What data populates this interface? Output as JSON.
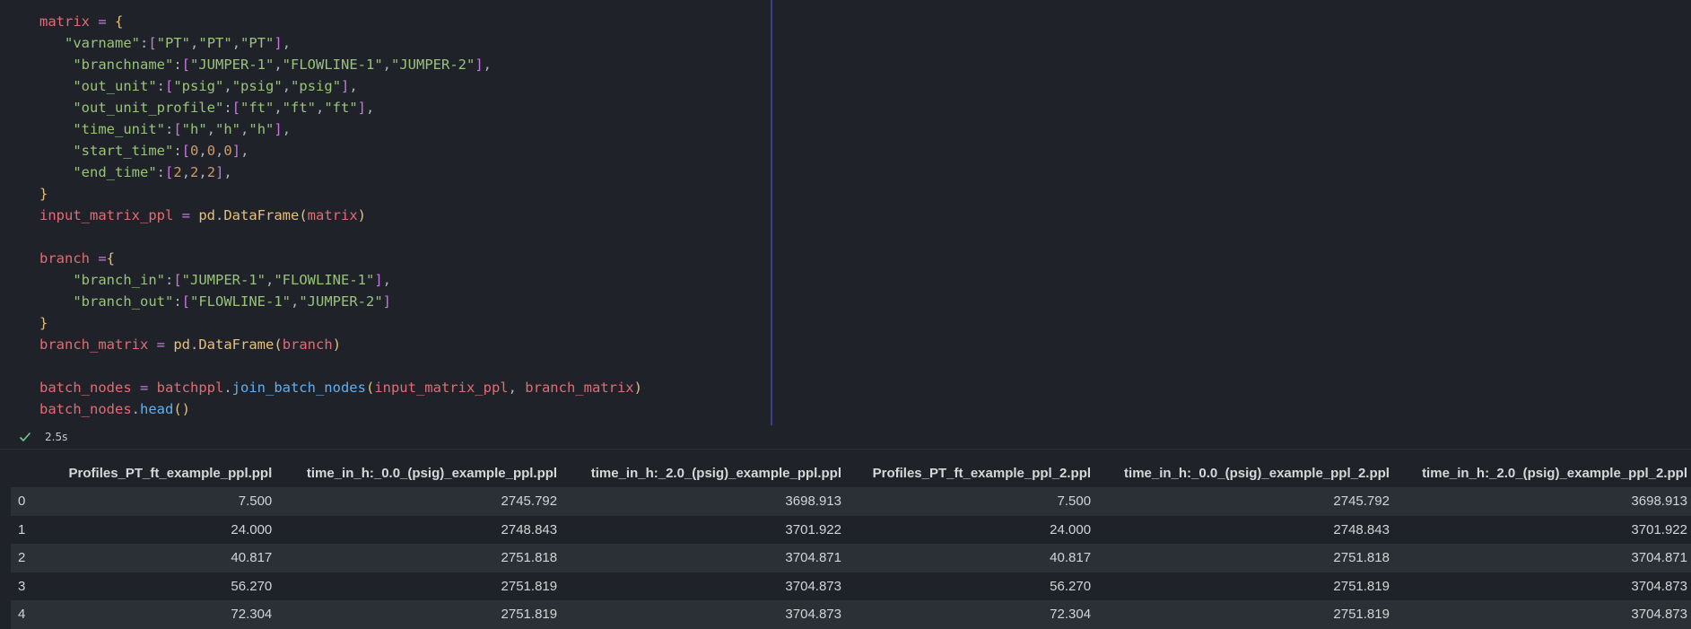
{
  "code_lines": [
    [
      [
        "v",
        "matrix"
      ],
      [
        "o",
        " = "
      ],
      [
        "br1",
        "{"
      ]
    ],
    [
      [
        "p",
        "   "
      ],
      [
        "s",
        "\"varname\""
      ],
      [
        "p",
        ":"
      ],
      [
        "br2",
        "["
      ],
      [
        "s",
        "\"PT\""
      ],
      [
        "p",
        ","
      ],
      [
        "s",
        "\"PT\""
      ],
      [
        "p",
        ","
      ],
      [
        "s",
        "\"PT\""
      ],
      [
        "br2",
        "]"
      ],
      [
        "p",
        ","
      ]
    ],
    [
      [
        "p",
        "    "
      ],
      [
        "s",
        "\"branchname\""
      ],
      [
        "p",
        ":"
      ],
      [
        "br2",
        "["
      ],
      [
        "s",
        "\"JUMPER-1\""
      ],
      [
        "p",
        ","
      ],
      [
        "s",
        "\"FLOWLINE-1\""
      ],
      [
        "p",
        ","
      ],
      [
        "s",
        "\"JUMPER-2\""
      ],
      [
        "br2",
        "]"
      ],
      [
        "p",
        ","
      ]
    ],
    [
      [
        "p",
        "    "
      ],
      [
        "s",
        "\"out_unit\""
      ],
      [
        "p",
        ":"
      ],
      [
        "br2",
        "["
      ],
      [
        "s",
        "\"psig\""
      ],
      [
        "p",
        ","
      ],
      [
        "s",
        "\"psig\""
      ],
      [
        "p",
        ","
      ],
      [
        "s",
        "\"psig\""
      ],
      [
        "br2",
        "]"
      ],
      [
        "p",
        ","
      ]
    ],
    [
      [
        "p",
        "    "
      ],
      [
        "s",
        "\"out_unit_profile\""
      ],
      [
        "p",
        ":"
      ],
      [
        "br2",
        "["
      ],
      [
        "s",
        "\"ft\""
      ],
      [
        "p",
        ","
      ],
      [
        "s",
        "\"ft\""
      ],
      [
        "p",
        ","
      ],
      [
        "s",
        "\"ft\""
      ],
      [
        "br2",
        "]"
      ],
      [
        "p",
        ","
      ]
    ],
    [
      [
        "p",
        "    "
      ],
      [
        "s",
        "\"time_unit\""
      ],
      [
        "p",
        ":"
      ],
      [
        "br2",
        "["
      ],
      [
        "s",
        "\"h\""
      ],
      [
        "p",
        ","
      ],
      [
        "s",
        "\"h\""
      ],
      [
        "p",
        ","
      ],
      [
        "s",
        "\"h\""
      ],
      [
        "br2",
        "]"
      ],
      [
        "p",
        ","
      ]
    ],
    [
      [
        "p",
        "    "
      ],
      [
        "s",
        "\"start_time\""
      ],
      [
        "p",
        ":"
      ],
      [
        "br2",
        "["
      ],
      [
        "n",
        "0"
      ],
      [
        "p",
        ","
      ],
      [
        "n",
        "0"
      ],
      [
        "p",
        ","
      ],
      [
        "n",
        "0"
      ],
      [
        "br2",
        "]"
      ],
      [
        "p",
        ","
      ]
    ],
    [
      [
        "p",
        "    "
      ],
      [
        "s",
        "\"end_time\""
      ],
      [
        "p",
        ":"
      ],
      [
        "br2",
        "["
      ],
      [
        "n",
        "2"
      ],
      [
        "p",
        ","
      ],
      [
        "n",
        "2"
      ],
      [
        "p",
        ","
      ],
      [
        "n",
        "2"
      ],
      [
        "br2",
        "]"
      ],
      [
        "p",
        ","
      ]
    ],
    [
      [
        "br1",
        "}"
      ]
    ],
    [
      [
        "v",
        "input_matrix_ppl"
      ],
      [
        "o",
        " = "
      ],
      [
        "b",
        "pd"
      ],
      [
        "p",
        "."
      ],
      [
        "b",
        "DataFrame"
      ],
      [
        "br1",
        "("
      ],
      [
        "v",
        "matrix"
      ],
      [
        "br1",
        ")"
      ]
    ],
    [
      [
        "p",
        ""
      ]
    ],
    [
      [
        "v",
        "branch"
      ],
      [
        "o",
        " ="
      ],
      [
        "br1",
        "{"
      ]
    ],
    [
      [
        "p",
        "    "
      ],
      [
        "s",
        "\"branch_in\""
      ],
      [
        "p",
        ":"
      ],
      [
        "br2",
        "["
      ],
      [
        "s",
        "\"JUMPER-1\""
      ],
      [
        "p",
        ","
      ],
      [
        "s",
        "\"FLOWLINE-1\""
      ],
      [
        "br2",
        "]"
      ],
      [
        "p",
        ","
      ]
    ],
    [
      [
        "p",
        "    "
      ],
      [
        "s",
        "\"branch_out\""
      ],
      [
        "p",
        ":"
      ],
      [
        "br2",
        "["
      ],
      [
        "s",
        "\"FLOWLINE-1\""
      ],
      [
        "p",
        ","
      ],
      [
        "s",
        "\"JUMPER-2\""
      ],
      [
        "br2",
        "]"
      ]
    ],
    [
      [
        "br1",
        "}"
      ]
    ],
    [
      [
        "v",
        "branch_matrix"
      ],
      [
        "o",
        " = "
      ],
      [
        "b",
        "pd"
      ],
      [
        "p",
        "."
      ],
      [
        "b",
        "DataFrame"
      ],
      [
        "br1",
        "("
      ],
      [
        "v",
        "branch"
      ],
      [
        "br1",
        ")"
      ]
    ],
    [
      [
        "p",
        ""
      ]
    ],
    [
      [
        "v",
        "batch_nodes"
      ],
      [
        "o",
        " = "
      ],
      [
        "v",
        "batchppl"
      ],
      [
        "p",
        "."
      ],
      [
        "f",
        "join_batch_nodes"
      ],
      [
        "br1",
        "("
      ],
      [
        "v",
        "input_matrix_ppl"
      ],
      [
        "p",
        ", "
      ],
      [
        "v",
        "branch_matrix"
      ],
      [
        "br1",
        ")"
      ]
    ],
    [
      [
        "v",
        "batch_nodes"
      ],
      [
        "p",
        "."
      ],
      [
        "f",
        "head"
      ],
      [
        "br1",
        "()"
      ]
    ]
  ],
  "status": {
    "icon": "check-icon",
    "duration": "2.5s",
    "success_color": "#73c991"
  },
  "table": {
    "index_header": "",
    "columns": [
      "Profiles_PT_ft_example_ppl.ppl",
      "time_in_h:_0.0_(psig)_example_ppl.ppl",
      "time_in_h:_2.0_(psig)_example_ppl.ppl",
      "Profiles_PT_ft_example_ppl_2.ppl",
      "time_in_h:_0.0_(psig)_example_ppl_2.ppl",
      "time_in_h:_2.0_(psig)_example_ppl_2.ppl"
    ],
    "rows": [
      {
        "index": "0",
        "values": [
          "7.500",
          "2745.792",
          "3698.913",
          "7.500",
          "2745.792",
          "3698.913"
        ]
      },
      {
        "index": "1",
        "values": [
          "24.000",
          "2748.843",
          "3701.922",
          "24.000",
          "2748.843",
          "3701.922"
        ]
      },
      {
        "index": "2",
        "values": [
          "40.817",
          "2751.818",
          "3704.871",
          "40.817",
          "2751.818",
          "3704.871"
        ]
      },
      {
        "index": "3",
        "values": [
          "56.270",
          "2751.819",
          "3704.873",
          "56.270",
          "2751.819",
          "3704.873"
        ]
      },
      {
        "index": "4",
        "values": [
          "72.304",
          "2751.819",
          "3704.873",
          "72.304",
          "2751.819",
          "3704.873"
        ]
      }
    ]
  }
}
